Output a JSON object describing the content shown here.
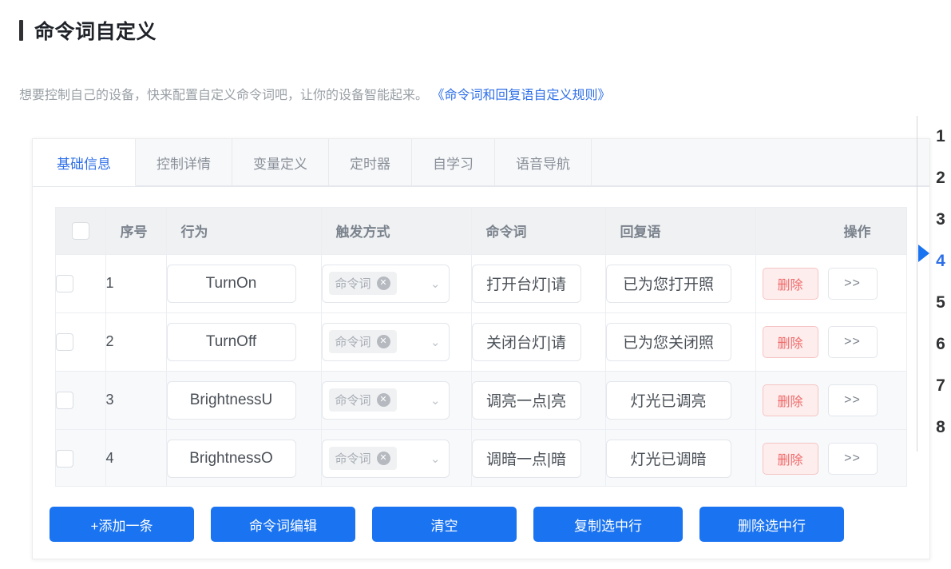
{
  "header": {
    "title": "命令词自定义",
    "description_prefix": "想要控制自己的设备，快来配置自定义命令词吧，让你的设备智能起来。",
    "description_link": "《命令词和回复语自定义规则》"
  },
  "tabs": [
    {
      "label": "基础信息",
      "active": true
    },
    {
      "label": "控制详情",
      "active": false
    },
    {
      "label": "变量定义",
      "active": false
    },
    {
      "label": "定时器",
      "active": false
    },
    {
      "label": "自学习",
      "active": false
    },
    {
      "label": "语音导航",
      "active": false
    }
  ],
  "table": {
    "columns": [
      "",
      "序号",
      "行为",
      "触发方式",
      "命令词",
      "回复语",
      "操作"
    ],
    "rows": [
      {
        "index": "1",
        "action": "TurnOn",
        "trigger_tag": "命令词",
        "command": "打开台灯|请",
        "reply": "已为您打开照",
        "delete_label": "删除",
        "more_label": ">>"
      },
      {
        "index": "2",
        "action": "TurnOff",
        "trigger_tag": "命令词",
        "command": "关闭台灯|请",
        "reply": "已为您关闭照",
        "delete_label": "删除",
        "more_label": ">>"
      },
      {
        "index": "3",
        "action": "BrightnessU",
        "trigger_tag": "命令词",
        "command": "调亮一点|亮",
        "reply": "灯光已调亮",
        "delete_label": "删除",
        "more_label": ">>"
      },
      {
        "index": "4",
        "action": "BrightnessO",
        "trigger_tag": "命令词",
        "command": "调暗一点|暗",
        "reply": "灯光已调暗",
        "delete_label": "删除",
        "more_label": ">>"
      }
    ]
  },
  "footer_buttons": [
    {
      "label": "+添加一条"
    },
    {
      "label": "命令词编辑"
    },
    {
      "label": "清空"
    },
    {
      "label": "复制选中行"
    },
    {
      "label": "删除选中行"
    }
  ],
  "rail": {
    "items": [
      "1",
      "2",
      "3",
      "4",
      "5",
      "6",
      "7",
      "8"
    ],
    "active": "4"
  },
  "colors": {
    "accent": "#1a73f0",
    "link": "#2e6fe8",
    "danger": "#f06a6a",
    "danger_bg": "#fdeded",
    "header_bg": "#f0f1f3"
  }
}
